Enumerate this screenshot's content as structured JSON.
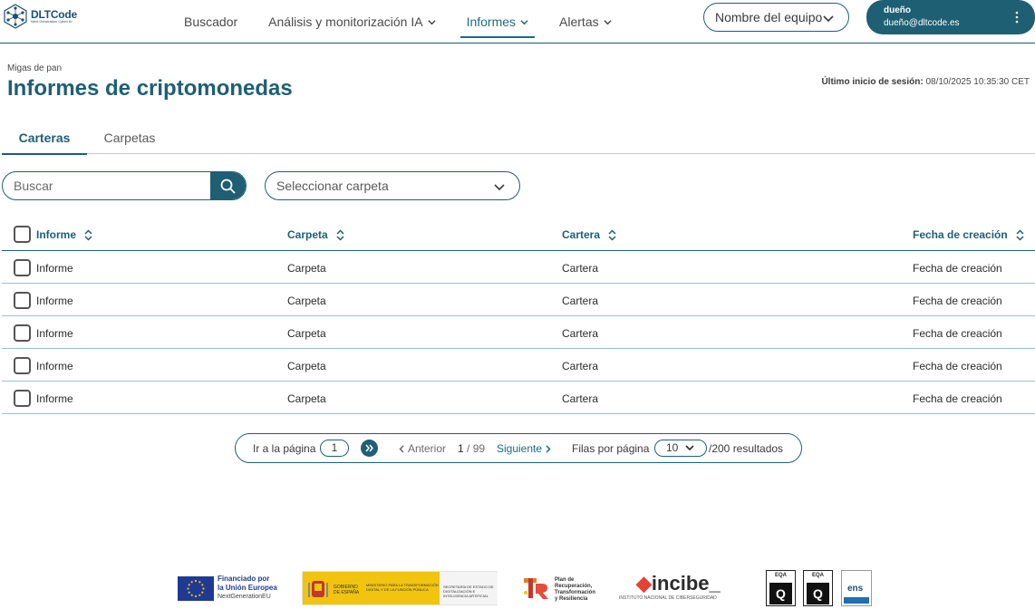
{
  "brand": {
    "name": "DLTCode",
    "tagline": "Next Generation Cyber AI"
  },
  "nav": {
    "items": [
      {
        "label": "Buscador",
        "has_chevron": false,
        "active": false
      },
      {
        "label": "Análisis y monitorización IA",
        "has_chevron": true,
        "active": false
      },
      {
        "label": "Informes",
        "has_chevron": true,
        "active": true
      },
      {
        "label": "Alertas",
        "has_chevron": true,
        "active": false
      }
    ],
    "team_select": "Nombre del equipo"
  },
  "user": {
    "name": "dueño",
    "email": "dueño@dltcode.es"
  },
  "page": {
    "breadcrumb": "Migas de pan",
    "title": "Informes de criptomonedas",
    "last_login_label": "Último inicio de sesión:",
    "last_login_value": "08/10/2025 10:35:30 CET"
  },
  "tabs": [
    {
      "label": "Carteras",
      "active": true
    },
    {
      "label": "Carpetas",
      "active": false
    }
  ],
  "filters": {
    "search_placeholder": "Buscar",
    "folder_placeholder": "Seleccionar carpeta"
  },
  "table": {
    "headers": [
      "Informe",
      "Carpeta",
      "Cartera",
      "Fecha de creación"
    ],
    "rows": [
      [
        "Informe",
        "Carpeta",
        "Cartera",
        "Fecha de creación"
      ],
      [
        "Informe",
        "Carpeta",
        "Cartera",
        "Fecha de creación"
      ],
      [
        "Informe",
        "Carpeta",
        "Cartera",
        "Fecha de creación"
      ],
      [
        "Informe",
        "Carpeta",
        "Cartera",
        "Fecha de creación"
      ],
      [
        "Informe",
        "Carpeta",
        "Cartera",
        "Fecha de creación"
      ]
    ]
  },
  "pagination": {
    "goto_label": "Ir a la página",
    "goto_value": "1",
    "prev_label": "Anterior",
    "current_page": "1",
    "total_pages": "/ 99",
    "next_label": "Siguiente",
    "rows_label": "Filas por página",
    "rows_value": "10",
    "total_results": "/200 resultados"
  },
  "footer": {
    "eu_line1": "Financiado por",
    "eu_line2": "la Unión Europea",
    "eu_line3": "NextGenerationEU",
    "gob_line1": "GOBIERNO DE ESPAÑA",
    "gob_line2": "MINISTERIO PARA LA TRANSFORMACIÓN DIGITAL Y DE LA FUNCIÓN PÚBLICA",
    "gob_line3": "SECRETARÍA DE ESTADO DE DIGITALIZACIÓN E INTELIGENCIA ARTIFICIAL",
    "prtr_line1": "Plan de",
    "prtr_line2": "Recuperación,",
    "prtr_line3": "Transformación",
    "prtr_line4": "y Resiliencia",
    "incibe_name": "incibe_",
    "incibe_sub": "INSTITUTO NACIONAL DE CIBERSEGURIDAD",
    "cert1_label": "EQA",
    "cert2_label": "EQA",
    "ens_label": "ens"
  },
  "colors": {
    "primary": "#1e5f74",
    "accent": "#1e6a80",
    "row_divider": "#9fbfc9"
  }
}
